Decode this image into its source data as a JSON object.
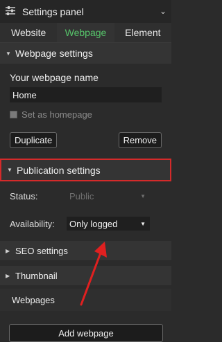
{
  "panel": {
    "title": "Settings panel",
    "icon": "sliders-icon"
  },
  "tabs": [
    {
      "label": "Website",
      "active": false
    },
    {
      "label": "Webpage",
      "active": true
    },
    {
      "label": "Element",
      "active": false
    }
  ],
  "webpage_settings": {
    "heading": "Webpage settings",
    "name_label": "Your webpage name",
    "name_value": "Home",
    "homepage_checkbox_label": "Set as homepage",
    "duplicate_label": "Duplicate",
    "remove_label": "Remove"
  },
  "publication_settings": {
    "heading": "Publication settings",
    "status_label": "Status:",
    "status_value": "Public",
    "availability_label": "Availability:",
    "availability_value": "Only logged"
  },
  "collapsed_sections": {
    "seo": "SEO settings",
    "thumbnail": "Thumbnail"
  },
  "webpages": {
    "heading": "Webpages",
    "add_label": "Add webpage"
  },
  "colors": {
    "accent_green": "#56c46a",
    "highlight_red": "#d42a2a",
    "arrow_red": "#e02020"
  }
}
